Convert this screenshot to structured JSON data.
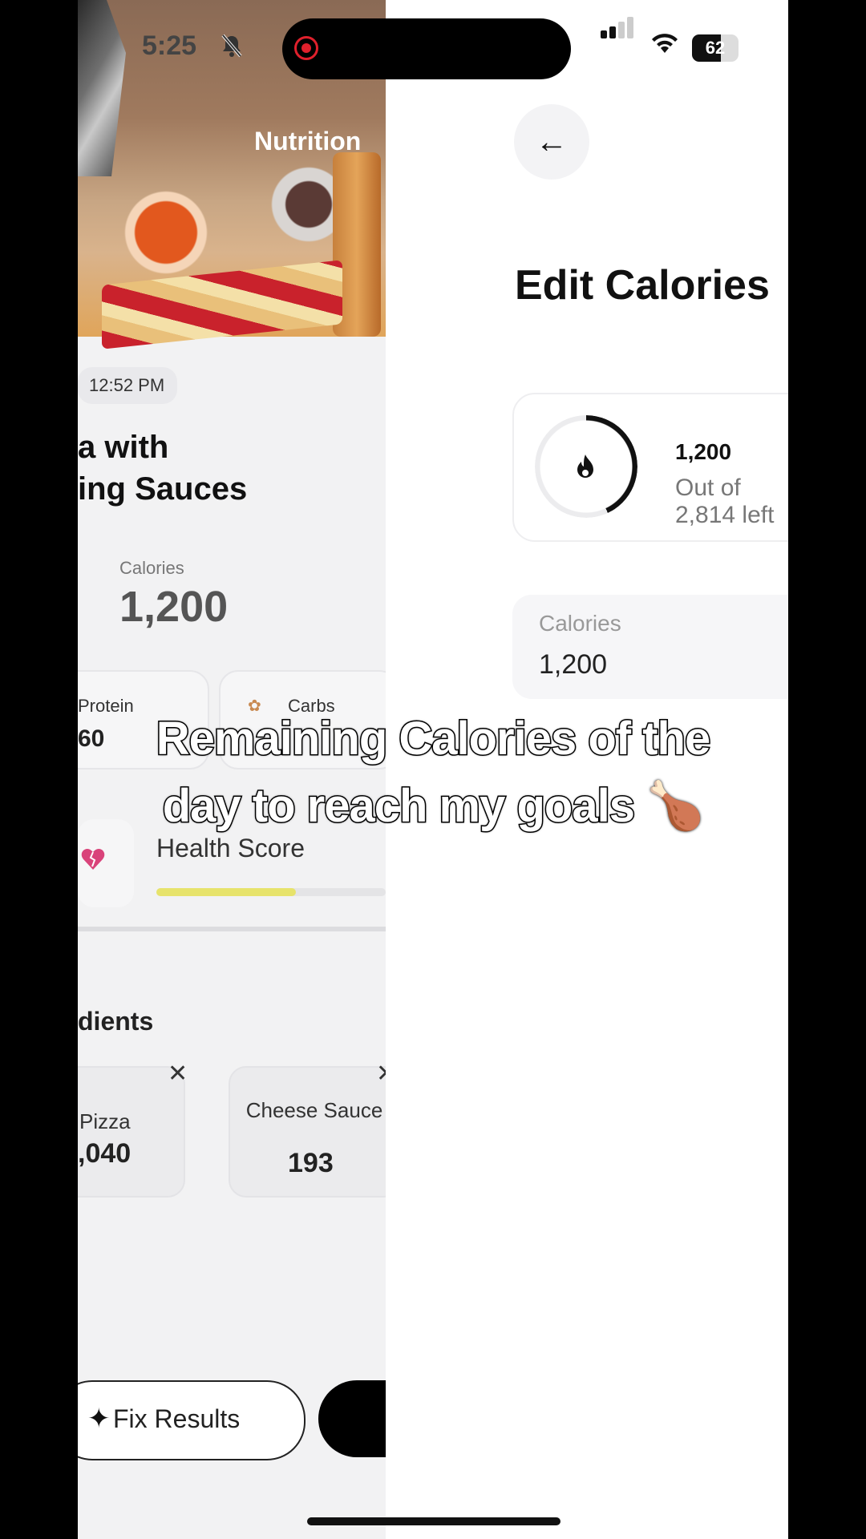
{
  "status_bar": {
    "time": "5:25",
    "battery": "62",
    "mute_icon": "bell-slash-icon",
    "recording_icon": "record-icon"
  },
  "nutrition_screen": {
    "title": "Nutrition",
    "time_chip": "12:52 PM",
    "food_name_line1": "a with",
    "food_name_line2": "ing Sauces",
    "calories_label": "Calories",
    "calories_value": "1,200",
    "macros": [
      {
        "label": "Protein",
        "value": "60"
      },
      {
        "label": "Carbs",
        "value": ""
      }
    ],
    "health_score_label": "Health Score",
    "health_score_fraction": 0.61,
    "ingredients_title": "dients",
    "ingredients": [
      {
        "name": "Pizza",
        "value": ",040"
      },
      {
        "name": "Cheese Sauce",
        "value": "193"
      }
    ],
    "fix_results_label": "Fix Results"
  },
  "edit_calories_screen": {
    "title": "Edit Calories",
    "summary_value": "1,200",
    "summary_sub": "Out of 2,814 left",
    "ring_fraction": 0.43,
    "input_label": "Calories",
    "input_value": "1,200"
  },
  "caption": {
    "line1": "Remaining Calories of the",
    "line2": "day to reach my goals 🍗"
  },
  "colors": {
    "accent_health": "#e7e36b",
    "heart": "#d9437a",
    "record": "#e0202c"
  }
}
